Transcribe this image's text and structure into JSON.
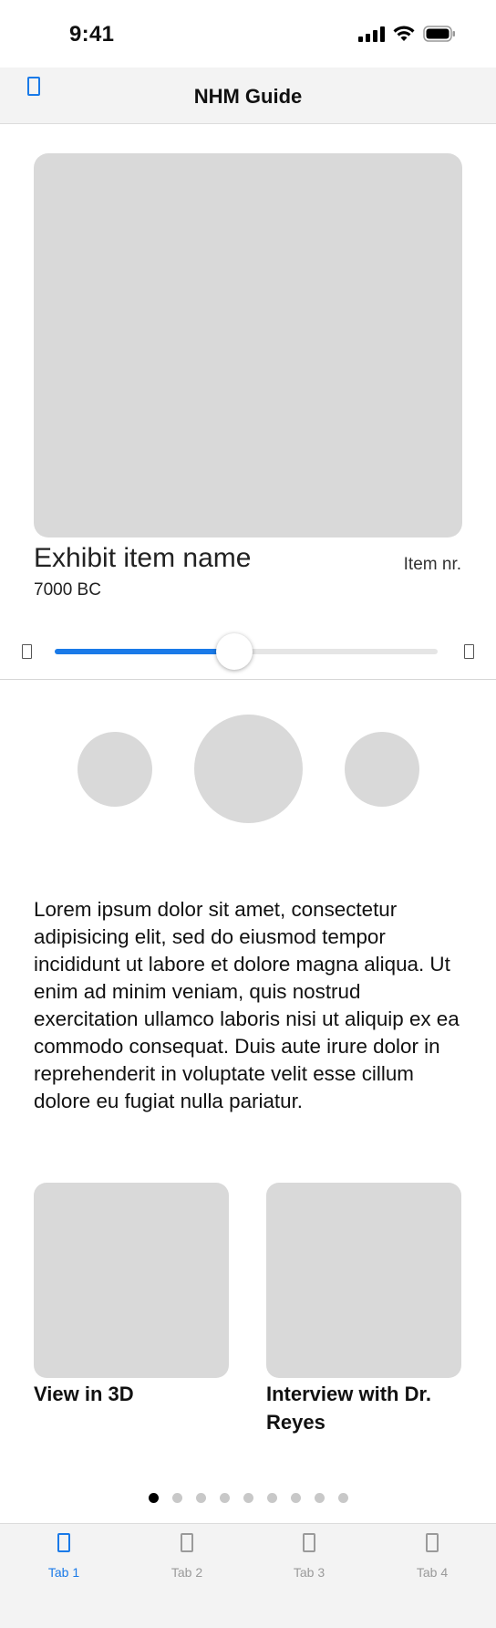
{
  "status_bar": {
    "time": "9:41"
  },
  "header": {
    "title": "NHM Guide",
    "menu_icon": "page-icon"
  },
  "exhibit": {
    "name": "Exhibit item name",
    "number_label": "Item nr.",
    "period": "7000 BC"
  },
  "timeline_slider": {
    "value_fraction": 0.47
  },
  "description": "Lorem ipsum dolor sit amet, consectetur adipisicing elit, sed do eiusmod tempor incididunt ut labore et dolore magna aliqua. Ut enim ad minim veniam, quis nostrud exercitation ullamco laboris nisi ut aliquip ex ea commodo consequat. Duis aute irure dolor in reprehenderit in voluptate velit esse cillum dolore eu fugiat nulla pariatur.",
  "cards": [
    {
      "label": "View in 3D"
    },
    {
      "label": "Interview with Dr. Reyes"
    }
  ],
  "pagination": {
    "total": 9,
    "active": 1
  },
  "tabs": [
    {
      "label": "Tab 1",
      "active": true
    },
    {
      "label": "Tab 2",
      "active": false
    },
    {
      "label": "Tab 3",
      "active": false
    },
    {
      "label": "Tab 4",
      "active": false
    }
  ],
  "colors": {
    "accent": "#1a7ae8",
    "placeholder": "#d9d9d9",
    "bar_bg": "#f3f3f3"
  }
}
